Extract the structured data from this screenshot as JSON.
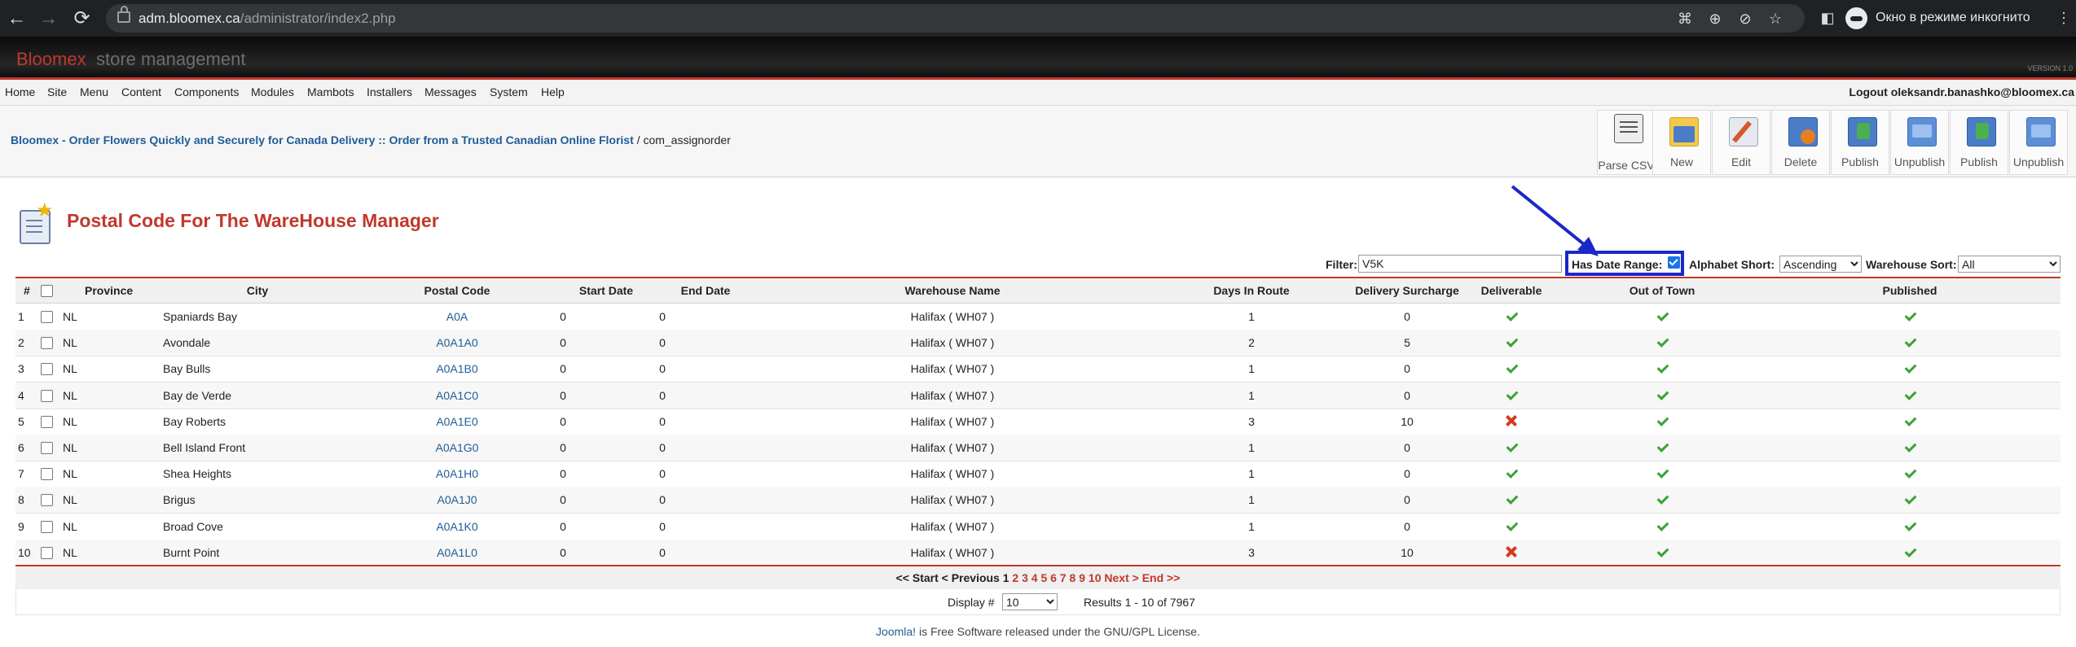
{
  "browser": {
    "url_host": "adm.bloomex.ca",
    "url_path": "/administrator/index2.php",
    "incognito_label": "Окно в режиме инкогнито"
  },
  "header": {
    "brand_red": "Bloomex",
    "brand_gray": "store management",
    "version": "VERSION 1.0"
  },
  "menu": {
    "items": [
      "Home",
      "Site",
      "Menu",
      "Content",
      "Components",
      "Modules",
      "Mambots",
      "Installers",
      "Messages",
      "System",
      "Help"
    ],
    "logout": "Logout oleksandr.banashko@bloomex.ca"
  },
  "breadcrumb": {
    "site_link": "Bloomex - Order Flowers Quickly and Securely for Canada Delivery :: Order from a Trusted Canadian Online Florist",
    "separator": "/",
    "component": "com_assignorder"
  },
  "toolbar": {
    "parse_csv": "Parse CSV",
    "new": "New",
    "edit": "Edit",
    "delete": "Delete",
    "publish": "Publish",
    "unpublish": "Unpublish"
  },
  "page": {
    "title": "Postal Code For The WareHouse Manager"
  },
  "filters": {
    "filter_label": "Filter:",
    "filter_value": "V5K",
    "date_range_label": "Has Date Range:",
    "date_range_checked": true,
    "alpha_label": "Alphabet Short:",
    "alpha_value": "Ascending",
    "wh_label": "Warehouse Sort:",
    "wh_value": "All"
  },
  "table": {
    "headers": {
      "num": "#",
      "province": "Province",
      "city": "City",
      "postal": "Postal Code",
      "start": "Start Date",
      "end": "End Date",
      "warehouse": "Warehouse Name",
      "days": "Days In Route",
      "surcharge": "Delivery Surcharge",
      "deliverable": "Deliverable",
      "oot": "Out of Town",
      "published": "Published"
    },
    "rows": [
      {
        "num": "1",
        "province": "NL",
        "city": "Spaniards Bay",
        "postal": "A0A",
        "start": "0",
        "end": "0",
        "warehouse": "Halifax ( WH07 )",
        "days": "1",
        "surcharge": "0",
        "deliverable": true,
        "oot": true,
        "published": true
      },
      {
        "num": "2",
        "province": "NL",
        "city": "Avondale",
        "postal": "A0A1A0",
        "start": "0",
        "end": "0",
        "warehouse": "Halifax ( WH07 )",
        "days": "2",
        "surcharge": "5",
        "deliverable": true,
        "oot": true,
        "published": true
      },
      {
        "num": "3",
        "province": "NL",
        "city": "Bay Bulls",
        "postal": "A0A1B0",
        "start": "0",
        "end": "0",
        "warehouse": "Halifax ( WH07 )",
        "days": "1",
        "surcharge": "0",
        "deliverable": true,
        "oot": true,
        "published": true
      },
      {
        "num": "4",
        "province": "NL",
        "city": "Bay de Verde",
        "postal": "A0A1C0",
        "start": "0",
        "end": "0",
        "warehouse": "Halifax ( WH07 )",
        "days": "1",
        "surcharge": "0",
        "deliverable": true,
        "oot": true,
        "published": true
      },
      {
        "num": "5",
        "province": "NL",
        "city": "Bay Roberts",
        "postal": "A0A1E0",
        "start": "0",
        "end": "0",
        "warehouse": "Halifax ( WH07 )",
        "days": "3",
        "surcharge": "10",
        "deliverable": false,
        "oot": true,
        "published": true
      },
      {
        "num": "6",
        "province": "NL",
        "city": "Bell Island Front",
        "postal": "A0A1G0",
        "start": "0",
        "end": "0",
        "warehouse": "Halifax ( WH07 )",
        "days": "1",
        "surcharge": "0",
        "deliverable": true,
        "oot": true,
        "published": true
      },
      {
        "num": "7",
        "province": "NL",
        "city": "Shea Heights",
        "postal": "A0A1H0",
        "start": "0",
        "end": "0",
        "warehouse": "Halifax ( WH07 )",
        "days": "1",
        "surcharge": "0",
        "deliverable": true,
        "oot": true,
        "published": true
      },
      {
        "num": "8",
        "province": "NL",
        "city": "Brigus",
        "postal": "A0A1J0",
        "start": "0",
        "end": "0",
        "warehouse": "Halifax ( WH07 )",
        "days": "1",
        "surcharge": "0",
        "deliverable": true,
        "oot": true,
        "published": true
      },
      {
        "num": "9",
        "province": "NL",
        "city": "Broad Cove",
        "postal": "A0A1K0",
        "start": "0",
        "end": "0",
        "warehouse": "Halifax ( WH07 )",
        "days": "1",
        "surcharge": "0",
        "deliverable": true,
        "oot": true,
        "published": true
      },
      {
        "num": "10",
        "province": "NL",
        "city": "Burnt Point",
        "postal": "A0A1L0",
        "start": "0",
        "end": "0",
        "warehouse": "Halifax ( WH07 )",
        "days": "3",
        "surcharge": "10",
        "deliverable": false,
        "oot": true,
        "published": true
      }
    ]
  },
  "pagination": {
    "start": "<< Start",
    "prev": "< Previous",
    "current": "1",
    "pages": [
      "2",
      "3",
      "4",
      "5",
      "6",
      "7",
      "8",
      "9",
      "10"
    ],
    "next": "Next >",
    "end": "End >>"
  },
  "display": {
    "label": "Display #",
    "value": "10",
    "results": "Results 1 - 10 of 7967"
  },
  "footer": {
    "joomla_link": "Joomla!",
    "text": " is Free Software released under the GNU/GPL License."
  },
  "colors": {
    "accent_red": "#c0392b",
    "link_blue": "#1f5c98",
    "highlight_box": "#1a27c9",
    "check_green": "#3aa336",
    "cross_red": "#d63a1f"
  }
}
